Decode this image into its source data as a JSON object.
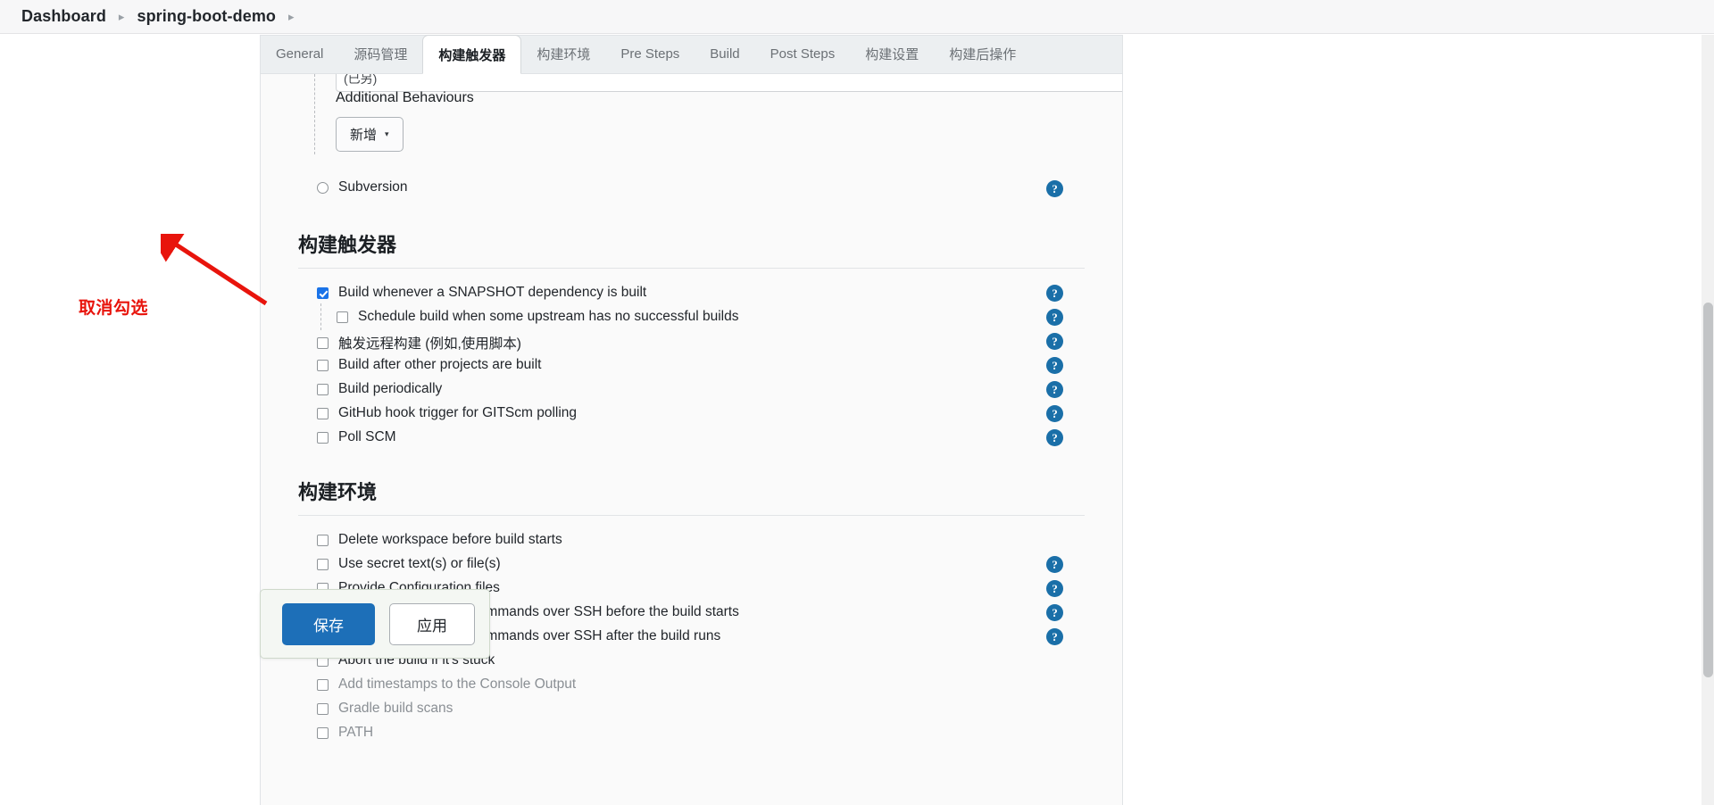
{
  "breadcrumb": {
    "items": [
      {
        "label": "Dashboard"
      },
      {
        "label": "spring-boot-demo"
      }
    ],
    "separator": "▸"
  },
  "tabs": [
    {
      "label": "General",
      "active": false
    },
    {
      "label": "源码管理",
      "active": false
    },
    {
      "label": "构建触发器",
      "active": true
    },
    {
      "label": "构建环境",
      "active": false
    },
    {
      "label": "Pre Steps",
      "active": false
    },
    {
      "label": "Build",
      "active": false
    },
    {
      "label": "Post Steps",
      "active": false
    },
    {
      "label": "构建设置",
      "active": false
    },
    {
      "label": "构建后操作",
      "active": false
    }
  ],
  "scm_section": {
    "clipped_field_value": "(已另)",
    "additional_behaviours_label": "Additional Behaviours",
    "add_button_label": "新增",
    "add_button_caret": "▾",
    "subversion_label": "Subversion",
    "subversion_checked": false
  },
  "triggers_section": {
    "heading": "构建触发器",
    "items": [
      {
        "label": "Build whenever a SNAPSHOT dependency is built",
        "checked": true,
        "nested": false,
        "help": true
      },
      {
        "label": "Schedule build when some upstream has no successful builds",
        "checked": false,
        "nested": true,
        "help": true
      },
      {
        "label": "触发远程构建 (例如,使用脚本)",
        "checked": false,
        "nested": false,
        "help": true
      },
      {
        "label": "Build after other projects are built",
        "checked": false,
        "nested": false,
        "help": true
      },
      {
        "label": "Build periodically",
        "checked": false,
        "nested": false,
        "help": true
      },
      {
        "label": "GitHub hook trigger for GITScm polling",
        "checked": false,
        "nested": false,
        "help": true
      },
      {
        "label": "Poll SCM",
        "checked": false,
        "nested": false,
        "help": true
      }
    ]
  },
  "environment_section": {
    "heading": "构建环境",
    "items": [
      {
        "label": "Delete workspace before build starts",
        "checked": false,
        "help": false
      },
      {
        "label": "Use secret text(s) or file(s)",
        "checked": false,
        "help": true
      },
      {
        "label": "Provide Configuration files",
        "checked": false,
        "help": true
      },
      {
        "label": "Send files or execute commands over SSH before the build starts",
        "checked": false,
        "help": true
      },
      {
        "label": "Send files or execute commands over SSH after the build runs",
        "checked": false,
        "help": true
      },
      {
        "label": "Abort the build if it's stuck",
        "checked": false,
        "help": false
      },
      {
        "label": "Add timestamps to the Console Output",
        "checked": false,
        "help": false
      },
      {
        "label": "Gradle build scans",
        "checked": false,
        "help": false
      },
      {
        "label": "PATH",
        "checked": false,
        "help": false
      }
    ]
  },
  "annotation": {
    "text": "取消勾选",
    "color": "#e8140c"
  },
  "savebar": {
    "save_label": "保存",
    "apply_label": "应用"
  },
  "help_icon_glyph": "?",
  "colors": {
    "accent": "#1a73e8",
    "save_button": "#1d6fb8",
    "help_icon": "#1a6fa8",
    "annotation": "#e8140c"
  }
}
